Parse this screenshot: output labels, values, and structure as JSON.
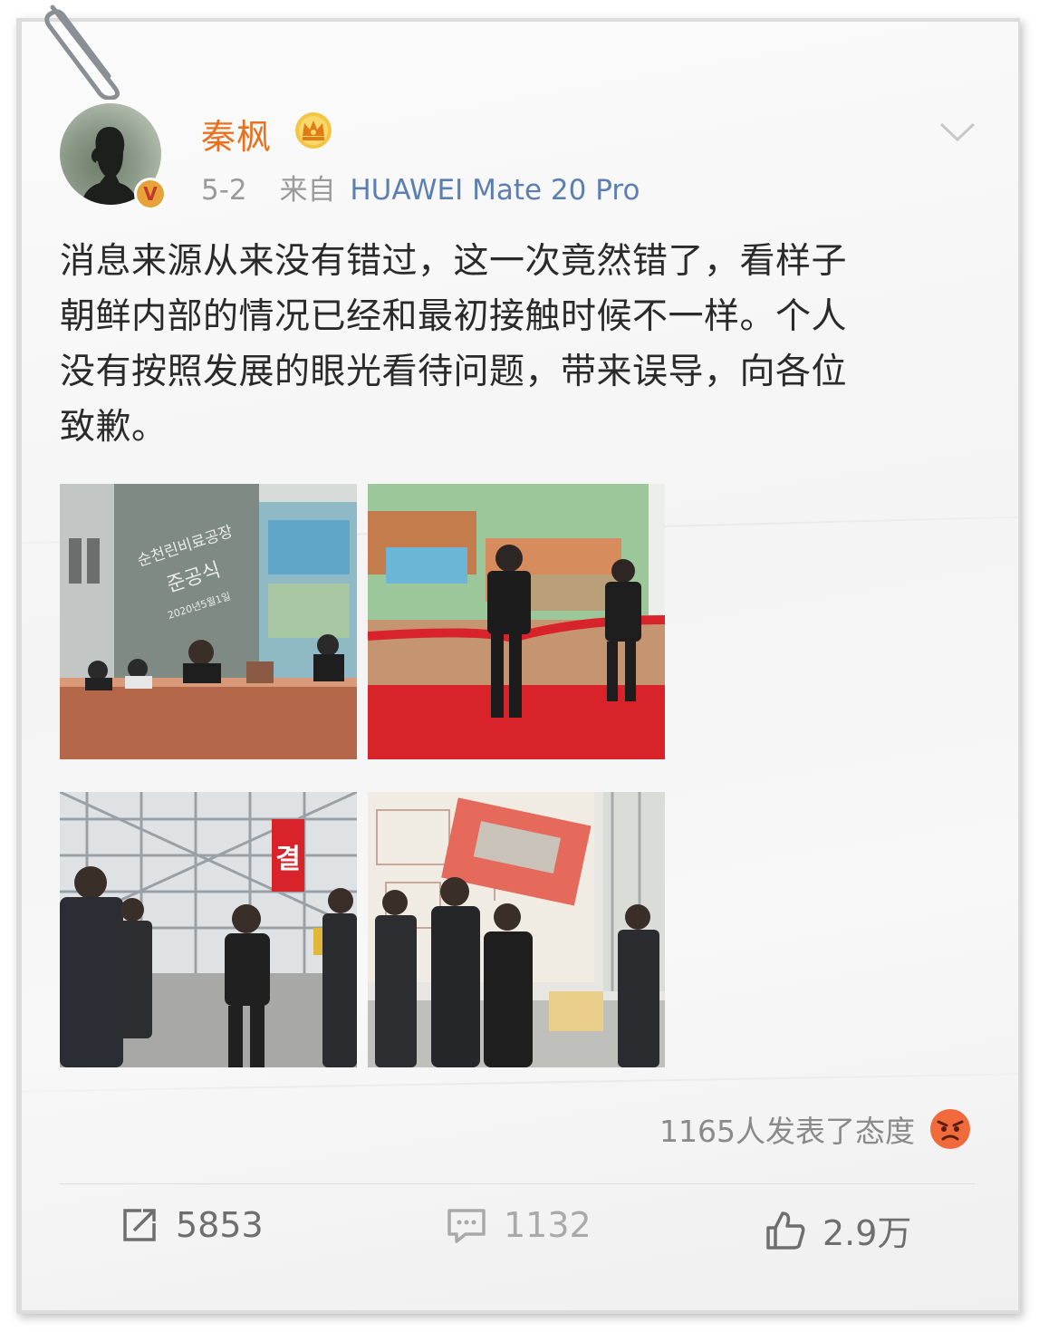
{
  "post": {
    "author": {
      "name": "秦枫",
      "verified_badge": "V",
      "membership_icon": "crown-icon"
    },
    "meta": {
      "date": "5-2",
      "source_prefix": "来自",
      "device": "HUAWEI Mate 20 Pro"
    },
    "text_lines": [
      "消息来源从来没有错过，这一次竟然错了，看样子",
      "朝鲜内部的情况已经和最初接触时候不一样。个人",
      "没有按照发展的眼光看待问题，带来误导，向各位",
      "致歉。"
    ],
    "photos": {
      "photo_1_sign_lines": [
        "순천린비료공장",
        "준공식",
        "2020년5월1일"
      ],
      "photo_3_sign": "결"
    },
    "reactions": {
      "label": "1165人发表了态度",
      "icon": "angry-icon"
    },
    "actions": {
      "repost": {
        "icon": "repost-icon",
        "count": "5853"
      },
      "comment": {
        "icon": "comment-icon",
        "count": "1132"
      },
      "like": {
        "icon": "thumbs-up-icon",
        "count": "2.9万"
      }
    }
  },
  "colors": {
    "username": "#e8711f",
    "device_link": "#5b7fb2",
    "meta_text": "#9a9a9a",
    "body_text": "#2a2a2a",
    "red_carpet": "#d8232a"
  }
}
